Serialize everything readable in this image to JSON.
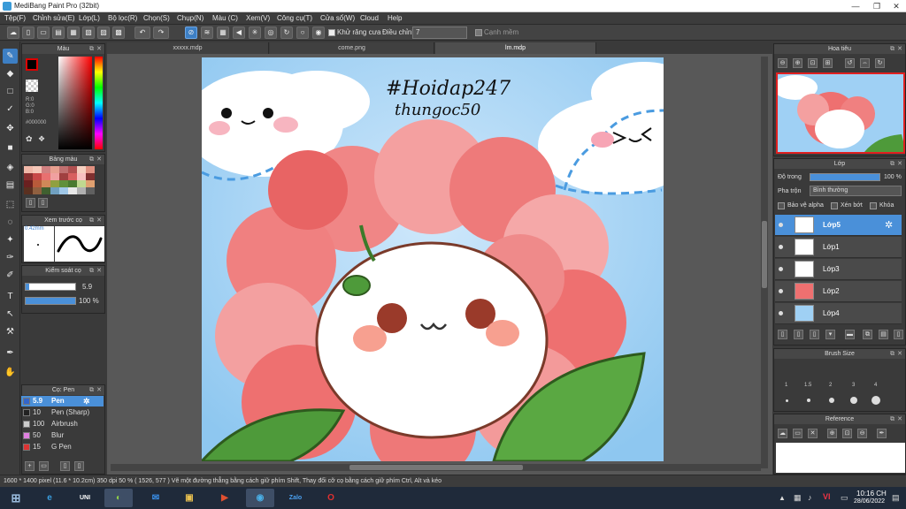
{
  "window": {
    "title": "MediBang Paint Pro (32bit)",
    "minimize": "—",
    "maximize": "❐",
    "close": "✕"
  },
  "menu": [
    "Tệp(F)",
    "Chỉnh sửa(E)",
    "Lớp(L)",
    "Bộ lọc(R)",
    "Chọn(S)",
    "Chụp(N)",
    "Màu (C)",
    "Xem(V)",
    "Công cụ(T)",
    "Cửa sổ(W)",
    "Cloud",
    "Help"
  ],
  "toolbar": {
    "antialias_label": "Khử răng cưa",
    "adjust_label": "Điều chỉnh",
    "adjust_value": "7",
    "snap_label": "Cạnh mềm"
  },
  "tabs": [
    "xxxxx.mdp",
    "come.png",
    "lm.mdp"
  ],
  "color_panel": {
    "title": "Màu",
    "r": "R:0",
    "g": "G:0",
    "b": "B:0",
    "hex": "#000000"
  },
  "palette_panel": {
    "title": "Bảng màu"
  },
  "preview_panel": {
    "title": "Xem trước cọ",
    "size": "0.42mm"
  },
  "brush_control": {
    "title": "Kiểm soát cọ",
    "size_value": "5.9",
    "opacity_value": "100 %"
  },
  "brush_panel": {
    "title": "Cọ: Pen",
    "items": [
      {
        "size": "5.9",
        "name": "Pen",
        "color": "#3366cc"
      },
      {
        "size": "10",
        "name": "Pen (Sharp)",
        "color": "#222222"
      },
      {
        "size": "100",
        "name": "Airbrush",
        "color": "#cccccc"
      },
      {
        "size": "50",
        "name": "Blur",
        "color": "#e080e0"
      },
      {
        "size": "15",
        "name": "G Pen",
        "color": "#dd3333"
      }
    ]
  },
  "navigator_panel": {
    "title": "Hoa tiêu"
  },
  "layer_panel": {
    "title": "Lớp",
    "opacity_label": "Độ trong",
    "opacity_value": "100 %",
    "blend_label": "Pha trộn",
    "blend_value": "Bình thường",
    "protect_alpha": "Bảo vệ alpha",
    "clipping": "Xén bớt",
    "lock": "Khóa",
    "layers": [
      "Lớp5",
      "Lớp1",
      "Lớp3",
      "Lớp2",
      "Lớp4"
    ]
  },
  "brush_size_panel": {
    "title": "Brush Size",
    "sizes": [
      "1",
      "1.5",
      "2",
      "3",
      "4"
    ]
  },
  "reference_panel": {
    "title": "Reference"
  },
  "artwork_text": {
    "line1": "#Hoidap247",
    "line2": "thungoc50"
  },
  "statusbar": {
    "text": "1600 * 1400 pixel   (11.6 * 10.2cm)   350 dpi   50 %   ( 1526, 577 )   Vẽ một đường thẳng bằng cách giữ phím Shift, Thay đổi cỡ cọ bằng cách giữ phím Ctrl, Alt và kéo"
  },
  "taskbar": {
    "apps": [
      "UNI",
      "e",
      "✉",
      "◐",
      "▣",
      "▶",
      "◉",
      "Zalo",
      "O"
    ],
    "time": "10:16 CH",
    "date": "28/06/2022",
    "lang": "VI"
  },
  "colors": {
    "accent": "#4a90d9",
    "sky": "#9fd0f4",
    "petal": "#ee6b6b",
    "leaf": "#4e9a3a"
  }
}
